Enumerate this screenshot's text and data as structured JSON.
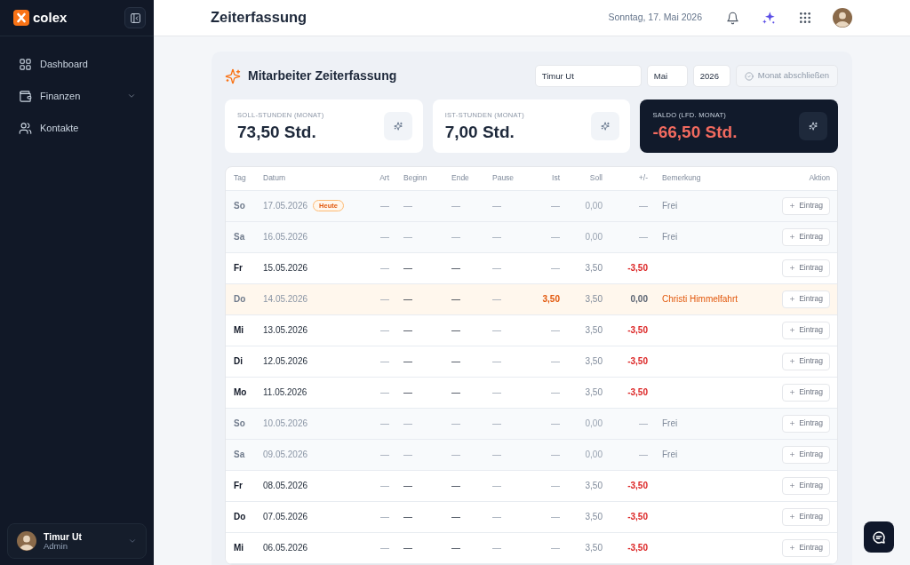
{
  "sidebar": {
    "brand": "colex",
    "nav": [
      {
        "label": "Dashboard",
        "selected": false,
        "submenu": false
      },
      {
        "label": "Finanzen",
        "selected": false,
        "submenu": true
      },
      {
        "label": "Kontakte",
        "selected": false,
        "submenu": false
      }
    ],
    "user": {
      "name": "Timur Ut",
      "role": "Admin"
    }
  },
  "header": {
    "title": "Zeiterfassung",
    "date": "Sonntag, 17. Mai 2026"
  },
  "panel": {
    "title": "Mitarbeiter Zeiterfassung",
    "employee_field": "Timur Ut",
    "month_field": "Mai",
    "year_field": "2026",
    "close_button": {
      "label": "Monat abschließen",
      "disabled": true
    },
    "stats": [
      {
        "label": "SOLL-STUNDEN (MONAT)",
        "value": "73,50 Std.",
        "highlight": false,
        "negative": false
      },
      {
        "label": "IST-STUNDEN (MONAT)",
        "value": "7,00 Std.",
        "highlight": false,
        "negative": false
      },
      {
        "label": "SALDO (LFD. MONAT)",
        "value": "-66,50 Std.",
        "highlight": true,
        "negative": true
      }
    ],
    "table": {
      "columns": [
        "Tag",
        "Datum",
        "Art",
        "Beginn",
        "Ende",
        "Pause",
        "Ist",
        "Soll",
        "+/-",
        "Bemerkung",
        "Aktion"
      ],
      "rows": [
        {
          "kind": "weekend",
          "day": "So",
          "date": "17.05.2026",
          "badge": "Heute",
          "art": "—",
          "begin": "—",
          "end": "—",
          "pause": "—",
          "actual": "—",
          "target": "0,00",
          "diff": "—",
          "note": "Frei",
          "action": "Eintrag"
        },
        {
          "kind": "weekend",
          "day": "Sa",
          "date": "16.05.2026",
          "art": "—",
          "begin": "—",
          "end": "—",
          "pause": "—",
          "actual": "—",
          "target": "0,00",
          "diff": "—",
          "note": "Frei",
          "action": "Eintrag"
        },
        {
          "kind": "workday",
          "day": "Fr",
          "date": "15.05.2026",
          "art": "—",
          "begin": "—",
          "end": "—",
          "pause": "—",
          "actual": "—",
          "target": "3,50",
          "diff": "-3,50",
          "action": "Eintrag"
        },
        {
          "kind": "holiday",
          "day": "Do",
          "date": "14.05.2026",
          "art": "—",
          "begin": "—",
          "end": "—",
          "pause": "—",
          "actual": "3,50",
          "target": "3,50",
          "diff": "0,00",
          "note": "Christi Himmelfahrt",
          "action": "Eintrag"
        },
        {
          "kind": "workday",
          "day": "Mi",
          "date": "13.05.2026",
          "art": "—",
          "begin": "—",
          "end": "—",
          "pause": "—",
          "actual": "—",
          "target": "3,50",
          "diff": "-3,50",
          "action": "Eintrag"
        },
        {
          "kind": "workday",
          "day": "Di",
          "date": "12.05.2026",
          "art": "—",
          "begin": "—",
          "end": "—",
          "pause": "—",
          "actual": "—",
          "target": "3,50",
          "diff": "-3,50",
          "action": "Eintrag"
        },
        {
          "kind": "workday",
          "day": "Mo",
          "date": "11.05.2026",
          "art": "—",
          "begin": "—",
          "end": "—",
          "pause": "—",
          "actual": "—",
          "target": "3,50",
          "diff": "-3,50",
          "action": "Eintrag"
        },
        {
          "kind": "weekend",
          "day": "So",
          "date": "10.05.2026",
          "art": "—",
          "begin": "—",
          "end": "—",
          "pause": "—",
          "actual": "—",
          "target": "0,00",
          "diff": "—",
          "note": "Frei",
          "action": "Eintrag"
        },
        {
          "kind": "weekend",
          "day": "Sa",
          "date": "09.05.2026",
          "art": "—",
          "begin": "—",
          "end": "—",
          "pause": "—",
          "actual": "—",
          "target": "0,00",
          "diff": "—",
          "note": "Frei",
          "action": "Eintrag"
        },
        {
          "kind": "workday",
          "day": "Fr",
          "date": "08.05.2026",
          "art": "—",
          "begin": "—",
          "end": "—",
          "pause": "—",
          "actual": "—",
          "target": "3,50",
          "diff": "-3,50",
          "action": "Eintrag"
        },
        {
          "kind": "workday",
          "day": "Do",
          "date": "07.05.2026",
          "art": "—",
          "begin": "—",
          "end": "—",
          "pause": "—",
          "actual": "—",
          "target": "3,50",
          "diff": "-3,50",
          "action": "Eintrag"
        },
        {
          "kind": "workday",
          "day": "Mi",
          "date": "06.05.2026",
          "art": "—",
          "begin": "—",
          "end": "—",
          "pause": "—",
          "actual": "—",
          "target": "3,50",
          "diff": "-3,50",
          "action": "Eintrag"
        }
      ]
    }
  }
}
